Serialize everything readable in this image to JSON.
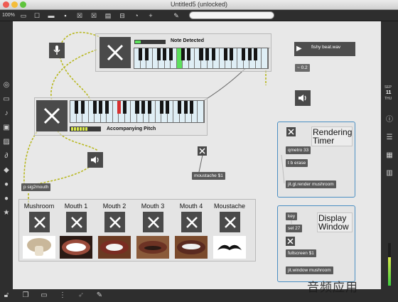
{
  "window": {
    "title": "Untitled5 (unlocked)"
  },
  "toolbar": {
    "zoom": "100%"
  },
  "keyboards": {
    "top_label": "Note Detected",
    "bottom_label": "Accompanying Pitch"
  },
  "player": {
    "file": "fishy beat.wav",
    "gain": "0.2"
  },
  "objects": {
    "moustache": "moustache $1",
    "sig2mouth": "p sig2mouth",
    "metro": "qmetro 33",
    "tb": "t b erase",
    "render": "jit.gl.render mushroom",
    "key": "key",
    "sel": "sel 27",
    "fullscreen": "fullscreen $1",
    "jitwindow": "jit.window mushroom"
  },
  "comments": {
    "rendering": "Rendering Timer",
    "display": "Display Window"
  },
  "faces": [
    "Mushroom",
    "Mouth 1",
    "Mouth 2",
    "Mouth 3",
    "Mouth 4",
    "Moustache"
  ],
  "rightbar_date": {
    "month": "SEP",
    "day": "11",
    "weekday": "THU"
  },
  "watermark": "音频应用",
  "colors": {
    "accent_blue": "#4a8ec2",
    "highlight_green": "#5ce05c",
    "highlight_red": "#d63030",
    "patch_cord": "#b8b820"
  }
}
